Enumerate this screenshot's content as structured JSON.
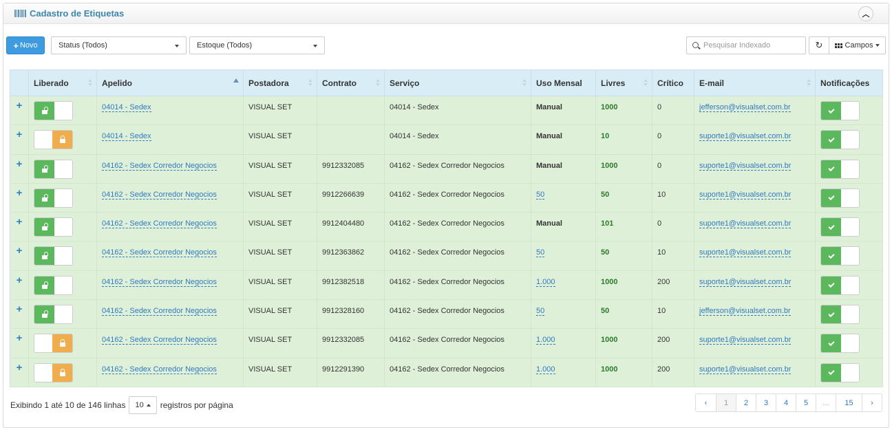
{
  "header": {
    "title": "Cadastro de Etiquetas",
    "collapse_icon": "chevron-up-icon"
  },
  "toolbar": {
    "novo_label": "Novo",
    "status_filter": "Status (Todos)",
    "estoque_filter": "Estoque (Todos)",
    "search_placeholder": "Pesquisar Indexado",
    "campos_label": "Campos"
  },
  "table": {
    "columns": [
      "Liberado",
      "Apelido",
      "Postadora",
      "Contrato",
      "Serviço",
      "Uso Mensal",
      "Livres",
      "Crítico",
      "E-mail",
      "Notificações"
    ],
    "rows": [
      {
        "liberado": true,
        "apelido": "04014 - Sedex",
        "postadora": "VISUAL SET",
        "contrato": "",
        "servico": "04014 - Sedex",
        "uso": "Manual",
        "uso_link": false,
        "livres": "1000",
        "critico": "0",
        "email": "jefferson@visualset.com.br",
        "notif": true
      },
      {
        "liberado": false,
        "apelido": "04014 - Sedex",
        "postadora": "VISUAL SET",
        "contrato": "",
        "servico": "04014 - Sedex",
        "uso": "Manual",
        "uso_link": false,
        "livres": "10",
        "critico": "0",
        "email": "suporte1@visualset.com.br",
        "notif": true
      },
      {
        "liberado": true,
        "apelido": "04162 - Sedex Corredor Negocios",
        "postadora": "VISUAL SET",
        "contrato": "9912332085",
        "servico": "04162 - Sedex Corredor Negocios",
        "uso": "Manual",
        "uso_link": false,
        "livres": "1000",
        "critico": "0",
        "email": "suporte1@visualset.com.br",
        "notif": true
      },
      {
        "liberado": true,
        "apelido": "04162 - Sedex Corredor Negocios",
        "postadora": "VISUAL SET",
        "contrato": "9912266639",
        "servico": "04162 - Sedex Corredor Negocios",
        "uso": "50",
        "uso_link": true,
        "livres": "50",
        "critico": "10",
        "email": "suporte1@visualset.com.br",
        "notif": true
      },
      {
        "liberado": true,
        "apelido": "04162 - Sedex Corredor Negocios",
        "postadora": "VISUAL SET",
        "contrato": "9912404480",
        "servico": "04162 - Sedex Corredor Negocios",
        "uso": "Manual",
        "uso_link": false,
        "livres": "101",
        "critico": "0",
        "email": "suporte1@visualset.com.br",
        "notif": true
      },
      {
        "liberado": true,
        "apelido": "04162 - Sedex Corredor Negocios",
        "postadora": "VISUAL SET",
        "contrato": "9912363862",
        "servico": "04162 - Sedex Corredor Negocios",
        "uso": "50",
        "uso_link": true,
        "livres": "50",
        "critico": "10",
        "email": "suporte1@visualset.com.br",
        "notif": true
      },
      {
        "liberado": true,
        "apelido": "04162 - Sedex Corredor Negocios",
        "postadora": "VISUAL SET",
        "contrato": "9912382518",
        "servico": "04162 - Sedex Corredor Negocios",
        "uso": "1.000",
        "uso_link": true,
        "livres": "1000",
        "critico": "200",
        "email": "suporte1@visualset.com.br",
        "notif": true
      },
      {
        "liberado": true,
        "apelido": "04162 - Sedex Corredor Negocios",
        "postadora": "VISUAL SET",
        "contrato": "9912328160",
        "servico": "04162 - Sedex Corredor Negocios",
        "uso": "50",
        "uso_link": true,
        "livres": "50",
        "critico": "10",
        "email": "jefferson@visualset.com.br",
        "notif": true
      },
      {
        "liberado": false,
        "apelido": "04162 - Sedex Corredor Negocios",
        "postadora": "VISUAL SET",
        "contrato": "9912332085",
        "servico": "04162 - Sedex Corredor Negocios",
        "uso": "1.000",
        "uso_link": true,
        "livres": "1000",
        "critico": "200",
        "email": "suporte1@visualset.com.br",
        "notif": true
      },
      {
        "liberado": false,
        "apelido": "04162 - Sedex Corredor Negocios",
        "postadora": "VISUAL SET",
        "contrato": "9912291390",
        "servico": "04162 - Sedex Corredor Negocios",
        "uso": "1.000",
        "uso_link": true,
        "livres": "1000",
        "critico": "200",
        "email": "suporte1@visualset.com.br",
        "notif": true
      }
    ]
  },
  "footer": {
    "showing": "Exibindo 1 até 10 de 146 linhas",
    "page_size": "10",
    "per_page": "registros por página",
    "pages": [
      "‹",
      "1",
      "2",
      "3",
      "4",
      "5",
      "...",
      "15",
      "›"
    ],
    "current_page": "1"
  },
  "colors": {
    "accent": "#3f9be0",
    "row_bg": "#dff0d8",
    "header_bg": "#d9edf7",
    "on": "#5cb85c",
    "off": "#f0ad4e"
  }
}
